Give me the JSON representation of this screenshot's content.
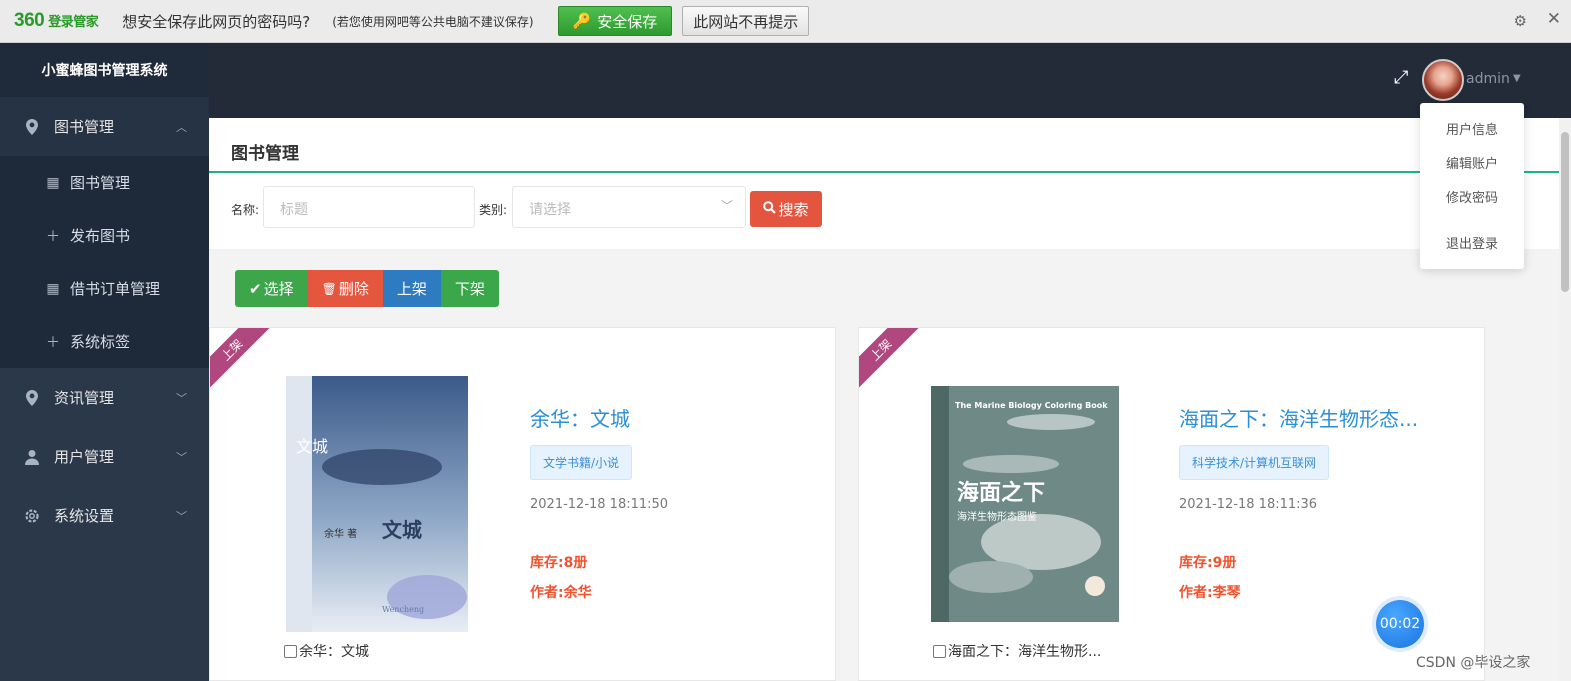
{
  "bar360": {
    "logo": "360",
    "logo_sub": "登录管家",
    "question": "想安全保存此网页的密码吗?",
    "note": "(若您使用网吧等公共电脑不建议保存)",
    "save_button": "安全保存",
    "nomore_button": "此网站不再提示"
  },
  "sidebar": {
    "brand": "小蜜蜂图书管理系统",
    "sections": [
      {
        "label": "图书管理",
        "icon": "location-pin-icon"
      },
      {
        "label": "资讯管理",
        "icon": "location-pin-icon"
      },
      {
        "label": "用户管理",
        "icon": "user-icon"
      },
      {
        "label": "系统设置",
        "icon": "gear-icon"
      }
    ],
    "sub_items": [
      {
        "label": "图书管理",
        "icon": "calendar-icon"
      },
      {
        "label": "发布图书",
        "icon": "plus-icon"
      },
      {
        "label": "借书订单管理",
        "icon": "calendar-icon"
      },
      {
        "label": "系统标签",
        "icon": "plus-icon"
      }
    ]
  },
  "topbar": {
    "username": "admin"
  },
  "user_menu": [
    "用户信息",
    "编辑账户",
    "修改密码",
    "退出登录"
  ],
  "page": {
    "title": "图书管理",
    "search": {
      "name_label": "名称:",
      "name_placeholder": "标题",
      "category_label": "类别:",
      "category_placeholder": "请选择",
      "search_button": "搜索"
    },
    "actions": {
      "select": "选择",
      "delete": "删除",
      "on_shelf": "上架",
      "off_shelf": "下架"
    }
  },
  "books": [
    {
      "ribbon": "上架",
      "title": "余华：文城",
      "category": "文学书籍/小说",
      "time": "2021-12-18 18:11:50",
      "stock": "库存:8册",
      "author": "作者:余华",
      "checkbox_label": "余华：文城",
      "cover_title": "文城",
      "cover_author": "余华 著",
      "cover_side": "文城",
      "cover_en": "Wencheng"
    },
    {
      "ribbon": "上架",
      "title": "海面之下：海洋生物形态...",
      "category": "科学技术/计算机互联网",
      "time": "2021-12-18 18:11:36",
      "stock": "库存:9册",
      "author": "作者:李琴",
      "checkbox_label": "海面之下：海洋生物形...",
      "cover_title": "海面之下",
      "cover_subtitle": "海洋生物形态图鉴",
      "cover_en": "The Marine Biology Coloring Book"
    }
  ],
  "overlay": {
    "timer": "00:02",
    "watermark": "CSDN @毕设之家"
  }
}
